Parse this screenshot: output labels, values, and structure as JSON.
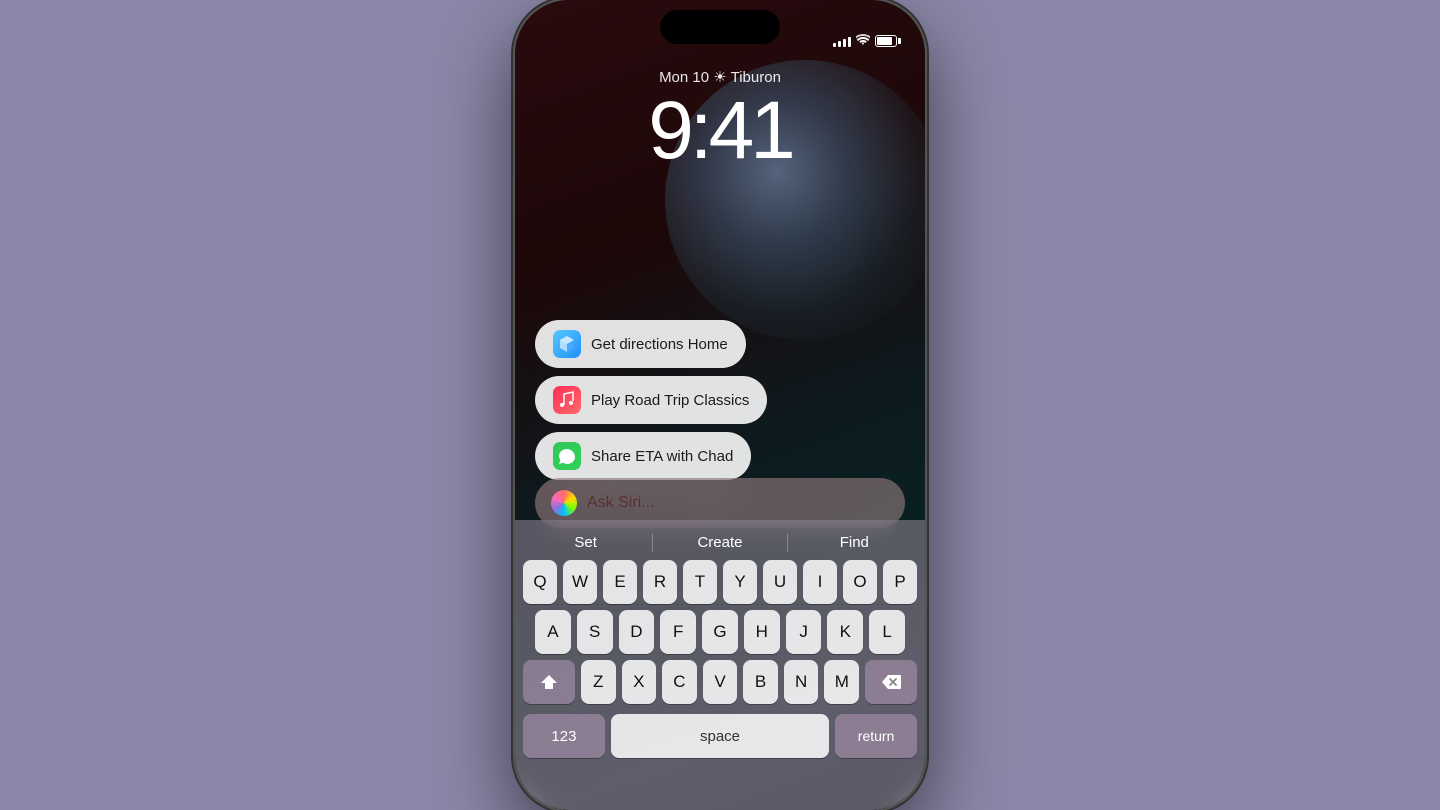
{
  "phone": {
    "status": {
      "time_hidden": "",
      "signal_bars": [
        3,
        6,
        9,
        12,
        15
      ],
      "battery_label": "battery"
    },
    "lock_screen": {
      "date_line": "Mon 10 ☀ Tiburon",
      "time": "9:41"
    },
    "suggestions": [
      {
        "id": "directions",
        "icon_type": "maps",
        "icon_emoji": "🗺",
        "label": "Get directions Home"
      },
      {
        "id": "music",
        "icon_type": "music",
        "icon_emoji": "♪",
        "label": "Play Road Trip Classics"
      },
      {
        "id": "share-eta",
        "icon_type": "messages",
        "icon_emoji": "💬",
        "label": "Share ETA with Chad"
      }
    ],
    "siri_bar": {
      "placeholder": "Ask Siri..."
    },
    "keyboard": {
      "predictive": [
        "Set",
        "Create",
        "Find"
      ],
      "row1": [
        "Q",
        "W",
        "E",
        "R",
        "T",
        "Y",
        "U",
        "I",
        "O",
        "P"
      ],
      "row2": [
        "A",
        "S",
        "D",
        "F",
        "G",
        "H",
        "J",
        "K",
        "L"
      ],
      "row3": [
        "Z",
        "X",
        "C",
        "V",
        "B",
        "N",
        "M"
      ],
      "bottom": {
        "num_label": "123",
        "space_label": "space",
        "return_label": "return"
      }
    }
  }
}
